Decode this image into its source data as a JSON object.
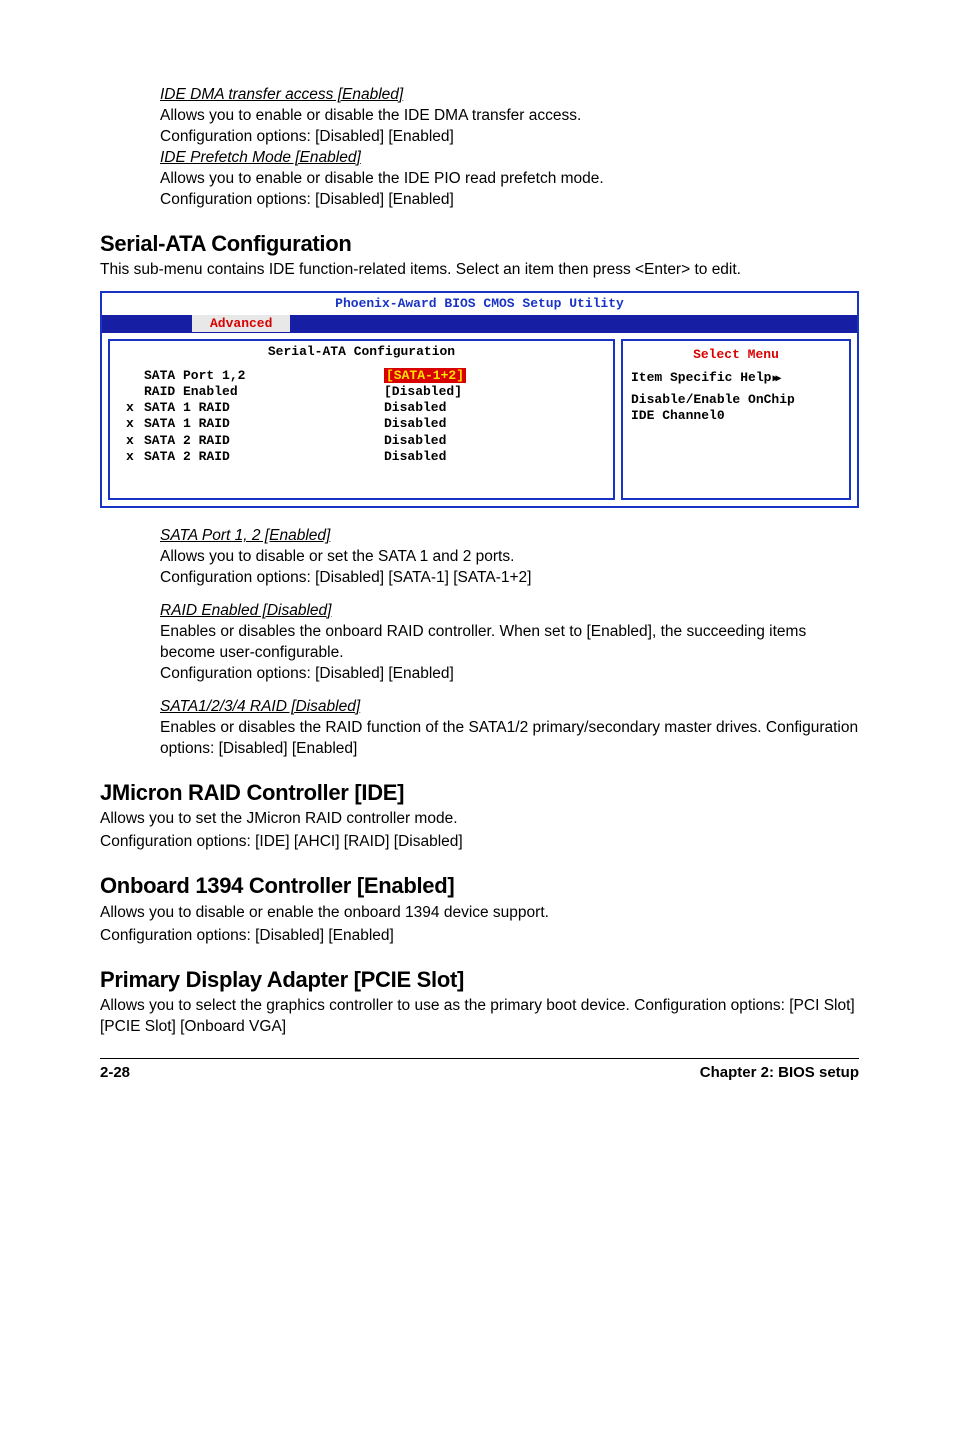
{
  "intro": {
    "ide_dma_title": "IDE DMA transfer access [Enabled]",
    "ide_dma_line1": "Allows you to enable or disable the IDE DMA transfer access.",
    "ide_dma_line2": "Configuration options: [Disabled] [Enabled]",
    "ide_pre_title": "IDE Prefetch Mode [Enabled]",
    "ide_pre_line1": "Allows you to enable or disable the IDE PIO read prefetch mode.",
    "ide_pre_line2": "Configuration options: [Disabled] [Enabled]"
  },
  "serial_ata": {
    "heading": "Serial-ATA Configuration",
    "lead": "This sub-menu contains IDE function-related items. Select an item then press <Enter> to edit."
  },
  "bios": {
    "title": "Phoenix-Award BIOS CMOS Setup Utility",
    "tab": "Advanced",
    "left_title": "Serial-ATA Configuration",
    "right_title": "Select Menu",
    "rows": [
      {
        "prefix": "",
        "label": "SATA Port 1,2",
        "value_wrap": "highlight",
        "value": "[SATA-1+2]"
      },
      {
        "prefix": "",
        "label": "RAID Enabled",
        "value": "[Disabled]"
      },
      {
        "prefix": "x",
        "label": "SATA 1 RAID",
        "value": "Disabled"
      },
      {
        "prefix": "x",
        "label": "SATA 1 RAID",
        "value": "Disabled"
      },
      {
        "prefix": "x",
        "label": "SATA 2 RAID",
        "value": "Disabled"
      },
      {
        "prefix": "x",
        "label": "SATA 2 RAID",
        "value": "Disabled"
      }
    ],
    "help_line1": "Item Specific Help",
    "help_line2": "Disable/Enable OnChip",
    "help_line3": "IDE Channel0"
  },
  "after_bios": {
    "sata_port_title": "SATA Port 1, 2 [Enabled]",
    "sata_port_line1": "Allows you to disable or set the SATA 1 and 2 ports.",
    "sata_port_line2": "Configuration options: [Disabled] [SATA-1] [SATA-1+2]",
    "raid_en_title": "RAID Enabled [Disabled]",
    "raid_en_line1": "Enables or disables the onboard RAID controller. When set to [Enabled], the succeeding items become user-configurable.",
    "raid_en_line2": "Configuration options: [Disabled] [Enabled]",
    "sata1234_title": "SATA1/2/3/4 RAID [Disabled]",
    "sata1234_line1": "Enables or disables the RAID function of the SATA1/2 primary/secondary master drives. Configuration options: [Disabled] [Enabled]"
  },
  "jmicron": {
    "heading": "JMicron RAID Controller [IDE]",
    "line1": "Allows you to set the JMicron RAID controller mode.",
    "line2": "Configuration options: [IDE] [AHCI] [RAID] [Disabled]"
  },
  "onboard1394": {
    "heading": "Onboard 1394 Controller [Enabled]",
    "line1": "Allows you to disable or enable the onboard 1394 device support.",
    "line2": "Configuration options: [Disabled] [Enabled]"
  },
  "primary_disp": {
    "heading": "Primary Display Adapter [PCIE Slot]",
    "line1": "Allows you to select the graphics controller to use as the primary boot device. Configuration options: [PCI Slot] [PCIE Slot] [Onboard VGA]"
  },
  "footer": {
    "left": "2-28",
    "right": "Chapter 2: BIOS setup"
  }
}
